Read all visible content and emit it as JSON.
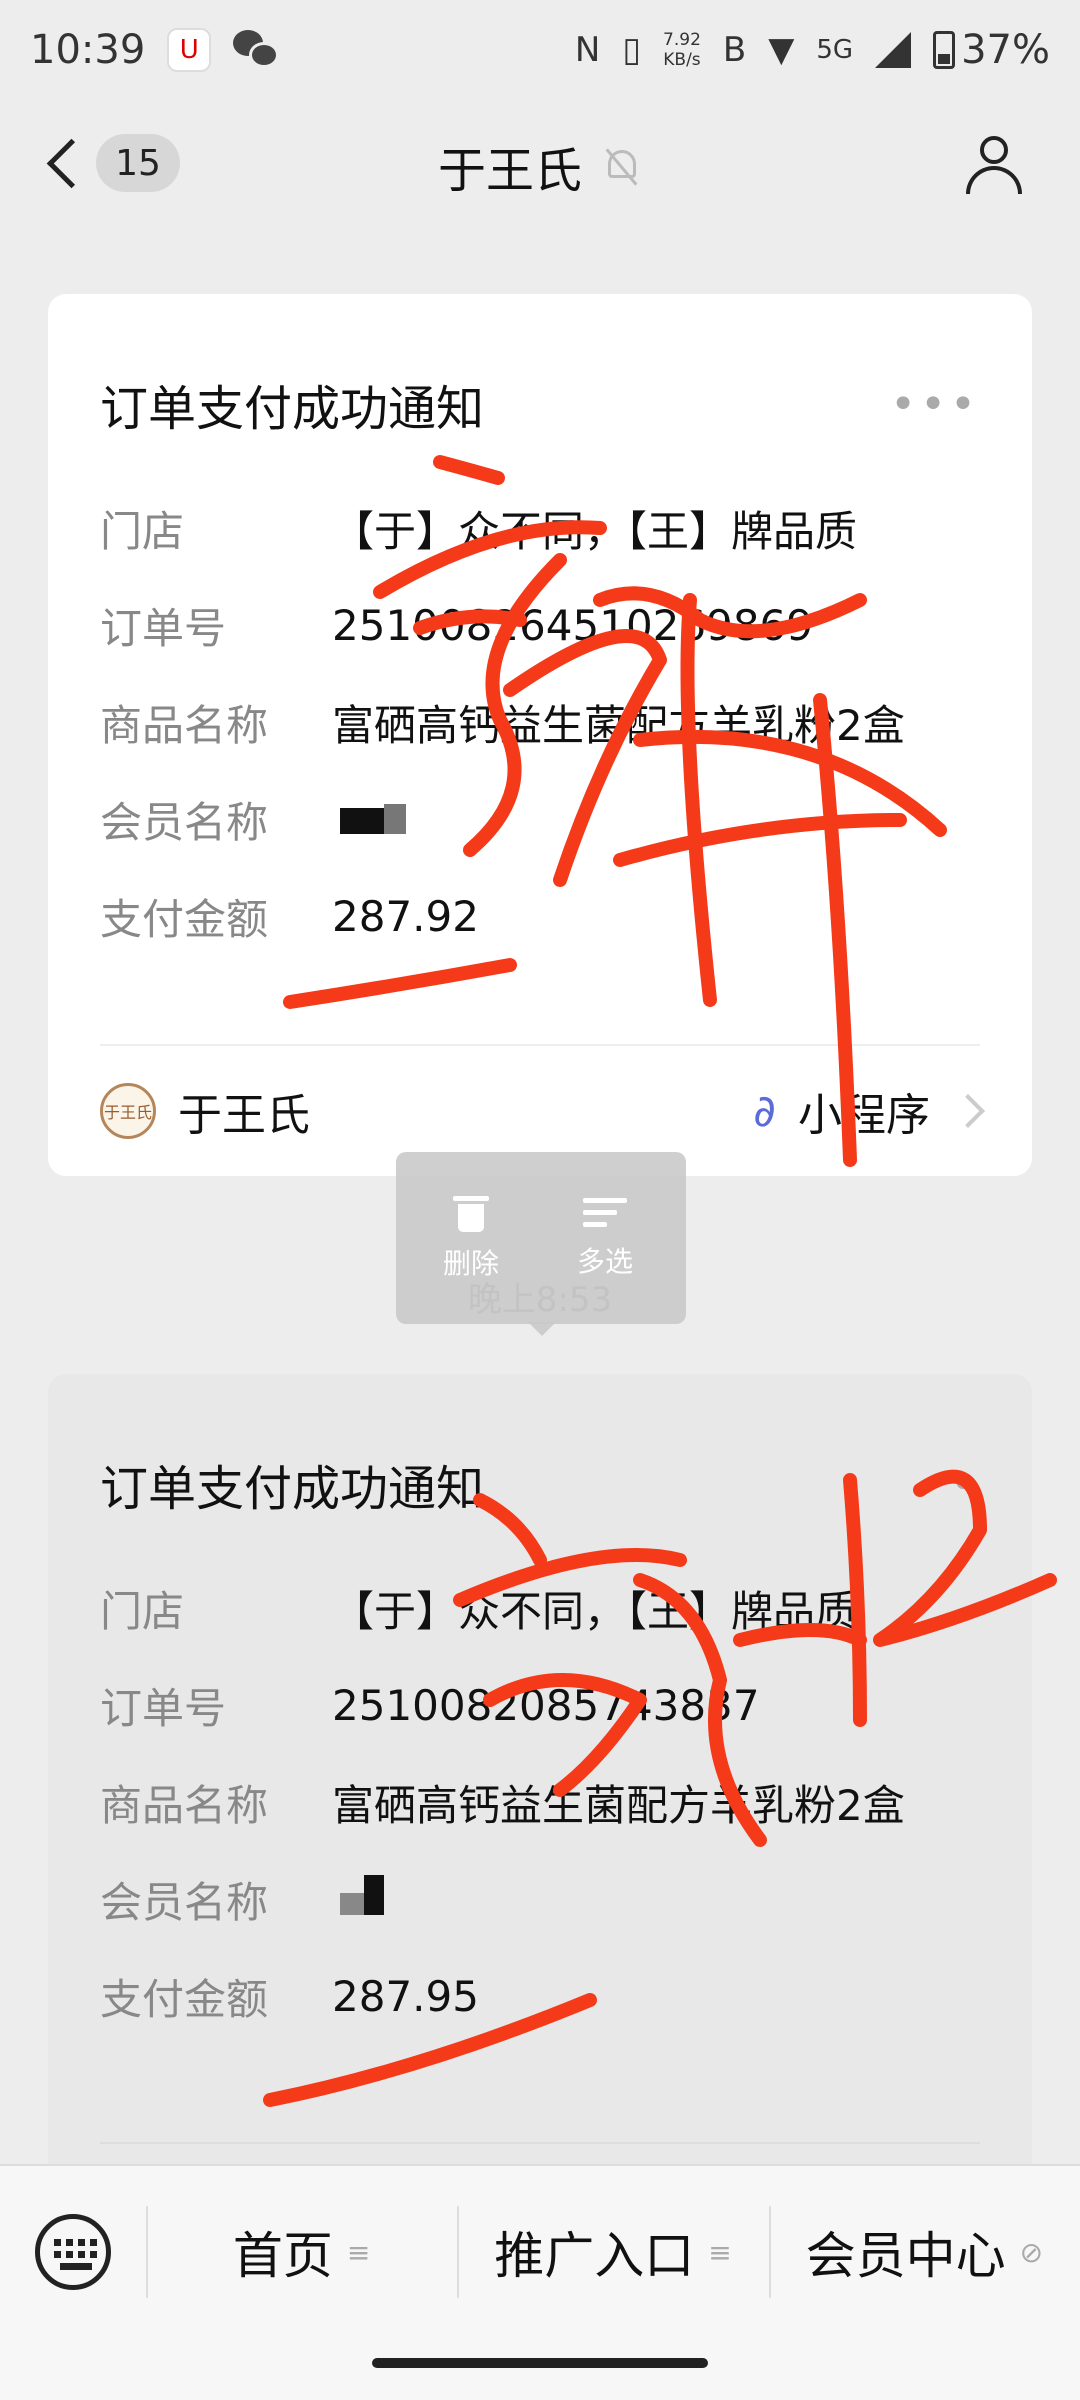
{
  "status_bar": {
    "time": "10:39",
    "app_icon_text": "U",
    "nfc": "N",
    "vibrate": "▯",
    "net_speed_value": "7.92",
    "net_speed_unit": "KB/s",
    "hd": "B",
    "network": "5G",
    "battery": "37%",
    "battery_level": 0.37
  },
  "header": {
    "unread_count": "15",
    "title": "于王氏"
  },
  "messages": [
    {
      "title": "订单支付成功通知",
      "more": "•••",
      "rows": [
        {
          "label": "门店",
          "value": "【于】众不同，【王】牌品质"
        },
        {
          "label": "订单号",
          "value": "2510082645102​69869"
        },
        {
          "label": "商品名称",
          "value": "富硒高钙益生菌配方羊乳粉2盒"
        },
        {
          "label": "会员名称",
          "value": ""
        },
        {
          "label": "支付金额",
          "value": "287.92"
        }
      ],
      "footer": {
        "brand_logo_text": "于王氏",
        "brand": "于王氏",
        "mini_program_icon": "∂",
        "mini_program": "小程序"
      }
    },
    {
      "title": "订单支付成功通知",
      "more": "••",
      "rows": [
        {
          "label": "门店",
          "value": "【于】众不同，【王】牌品质"
        },
        {
          "label": "订单号",
          "value": "2510082085743837"
        },
        {
          "label": "商品名称",
          "value": "富硒高钙益生菌配方羊乳粉2盒"
        },
        {
          "label": "会员名称",
          "value": ""
        },
        {
          "label": "支付金额",
          "value": "287.95"
        }
      ]
    }
  ],
  "context_menu": {
    "delete": "删除",
    "multi_select": "多选"
  },
  "timestamp": "晚上8:53",
  "bottom_menu": {
    "items": [
      {
        "label": "首页",
        "icon": "≡"
      },
      {
        "label": "推广入口",
        "icon": "≡"
      },
      {
        "label": "会员中心",
        "icon": "⊘"
      }
    ]
  },
  "colors": {
    "background": "#ededed",
    "card": "#ffffff",
    "scribble": "#f53a1a",
    "mini_program": "#5b6bd8"
  }
}
